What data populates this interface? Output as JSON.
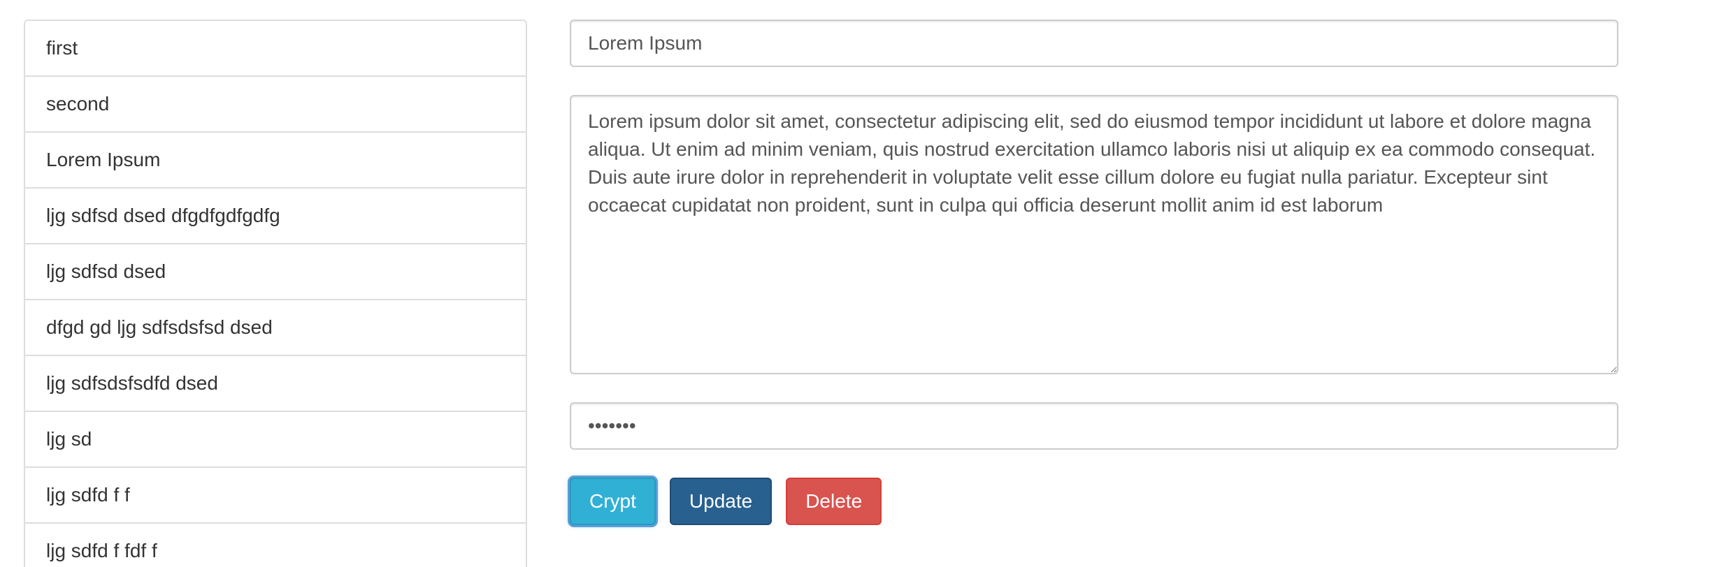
{
  "list": {
    "items": [
      {
        "label": "first"
      },
      {
        "label": "second"
      },
      {
        "label": "Lorem Ipsum"
      },
      {
        "label": "ljg sdfsd dsed dfgdfgdfgdfg"
      },
      {
        "label": "ljg sdfsd dsed"
      },
      {
        "label": "dfgd gd ljg sdfsdsfsd dsed"
      },
      {
        "label": "ljg sdfsdsfsdfd dsed"
      },
      {
        "label": "ljg sd"
      },
      {
        "label": "ljg sdfd f f"
      },
      {
        "label": "ljg sdfd f fdf f"
      }
    ]
  },
  "form": {
    "title_value": "Lorem Ipsum",
    "body_value": "Lorem ipsum dolor sit amet, consectetur adipiscing elit, sed do eiusmod tempor incididunt ut labore et dolore magna aliqua. Ut enim ad minim veniam, quis nostrud exercitation ullamco laboris nisi ut aliquip ex ea commodo consequat. Duis aute irure dolor in reprehenderit in voluptate velit esse cillum dolore eu fugiat nulla pariatur. Excepteur sint occaecat cupidatat non proident, sunt in culpa qui officia deserunt mollit anim id est laborum",
    "password_value": "1234567"
  },
  "buttons": {
    "crypt_label": "Crypt",
    "update_label": "Update",
    "delete_label": "Delete"
  },
  "colors": {
    "crypt": "#31b0d5",
    "update": "#286090",
    "delete": "#d9534f"
  }
}
